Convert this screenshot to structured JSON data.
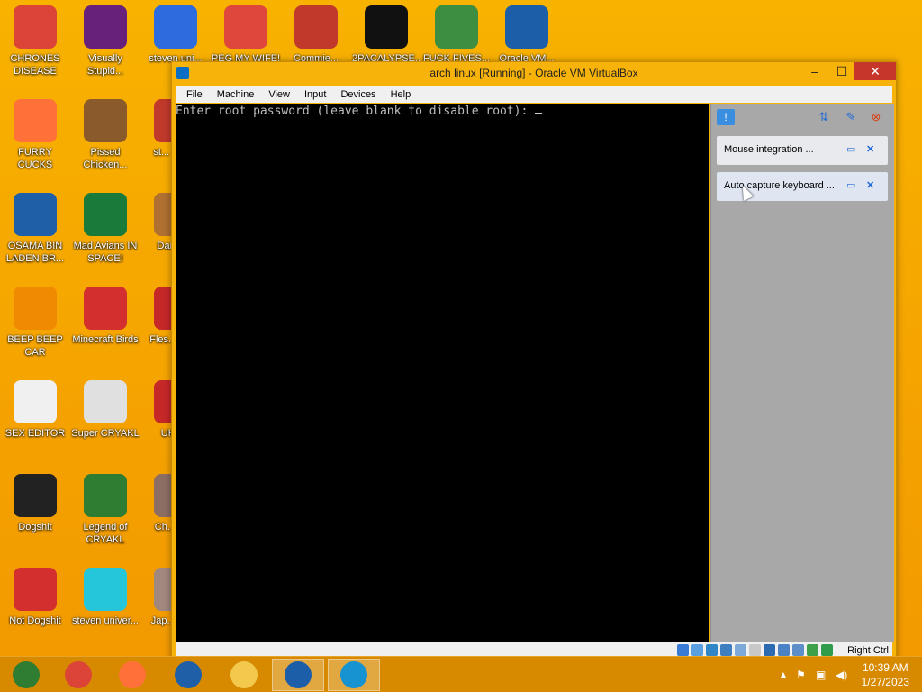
{
  "desktop": {
    "icons": [
      {
        "label": "CHRONES DISEASE",
        "icon": "chrome-icon",
        "color": "#db4437"
      },
      {
        "label": "Visually Stupid...",
        "icon": "visual-studio-icon",
        "color": "#68217a"
      },
      {
        "label": "steven uni...",
        "icon": "app-icon",
        "color": "#2d6cdf"
      },
      {
        "label": "PEG MY WIFE!",
        "icon": "peggle-icon",
        "color": "#e0473c"
      },
      {
        "label": "Commie...",
        "icon": "eagle-icon",
        "color": "#c0392b"
      },
      {
        "label": "2PACALYPSE...",
        "icon": "terminal-icon",
        "color": "#111111"
      },
      {
        "label": "FUCK FIVES...",
        "icon": "game-icon",
        "color": "#3e8e41"
      },
      {
        "label": "Oracle VM...",
        "icon": "virtualbox-icon",
        "color": "#1d5ea8"
      },
      {
        "label": "FURRY CUCKS",
        "icon": "firefox-icon",
        "color": "#ff7139"
      },
      {
        "label": "Pissed Chicken...",
        "icon": "chicken-icon",
        "color": "#8a5a2b"
      },
      {
        "label": "st... univ...",
        "icon": "app-icon",
        "color": "#c0392b"
      },
      {
        "label": "OSAMA BIN LADEN BR...",
        "icon": "obama-logo-icon",
        "color": "#1f5fa8"
      },
      {
        "label": "Mad Avians IN SPACE!",
        "icon": "angry-birds-space-icon",
        "color": "#1a7a3a"
      },
      {
        "label": "DarkO...",
        "icon": "app-icon",
        "color": "#b07030"
      },
      {
        "label": "BEEP BEEP CAR",
        "icon": "vlc-icon",
        "color": "#f08a00"
      },
      {
        "label": "Minecraft Birds",
        "icon": "angry-bird-icon",
        "color": "#d32f2f"
      },
      {
        "label": "Fles... DE...",
        "icon": "app-icon",
        "color": "#c62828"
      },
      {
        "label": "SEX EDITOR",
        "icon": "hxd-icon",
        "color": "#f0f0f0"
      },
      {
        "label": "Super CRYAKL",
        "icon": "pixel-art-icon",
        "color": "#e0e0e0"
      },
      {
        "label": "UKR...",
        "icon": "app-icon",
        "color": "#c62828"
      },
      {
        "label": "Dogshit",
        "icon": "disc-icon",
        "color": "#222222"
      },
      {
        "label": "Legend of CRYAKL",
        "icon": "character-icon",
        "color": "#2e7d32"
      },
      {
        "label": "Ch... Dr...",
        "icon": "app-icon",
        "color": "#8d6e63"
      },
      {
        "label": "Not Dogshit",
        "icon": "devcpp-icon",
        "color": "#d32f2f"
      },
      {
        "label": "steven univer...",
        "icon": "gem-icon",
        "color": "#26c6da"
      },
      {
        "label": "Jap... Lot...",
        "icon": "app-icon",
        "color": "#a1887f"
      }
    ]
  },
  "vbox": {
    "title": "arch linux [Running] - Oracle VM VirtualBox",
    "min": "–",
    "max": "☐",
    "close": "✕",
    "menu": [
      "File",
      "Machine",
      "View",
      "Input",
      "Devices",
      "Help"
    ],
    "console_text": "Enter root password (leave blank to disable root): ",
    "notifications": [
      {
        "text": "Mouse integration ..."
      },
      {
        "text": "Auto capture keyboard ..."
      }
    ],
    "host_key": "Right Ctrl"
  },
  "taskbar": {
    "time": "10:39 AM",
    "date": "1/27/2023",
    "apps": [
      {
        "icon": "chrome-old-icon",
        "color": "#2e7d32"
      },
      {
        "icon": "chrome-icon",
        "color": "#db4437"
      },
      {
        "icon": "firefox-icon",
        "color": "#ff7139"
      },
      {
        "icon": "obama-logo-icon",
        "color": "#1f5fa8"
      },
      {
        "icon": "file-explorer-icon",
        "color": "#f2c94c"
      },
      {
        "icon": "virtualbox-icon",
        "color": "#1d5ea8"
      },
      {
        "icon": "arch-linux-icon",
        "color": "#1793d1"
      }
    ]
  }
}
